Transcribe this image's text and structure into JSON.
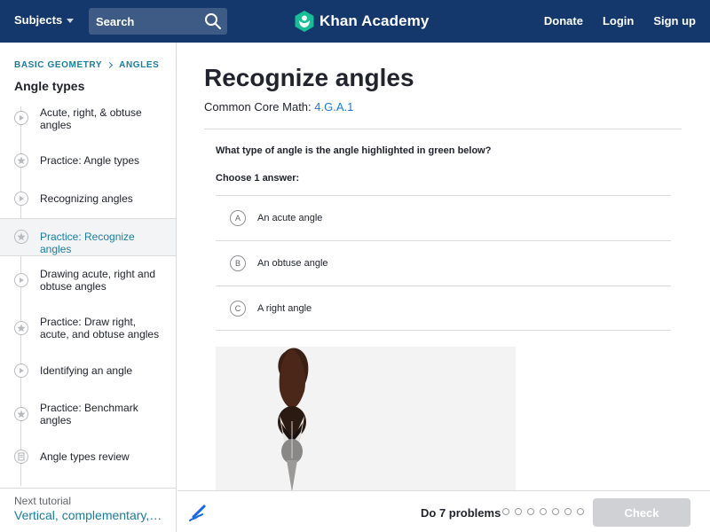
{
  "header": {
    "subjects_label": "Subjects",
    "search_placeholder": "Search",
    "brand_name": "Khan Academy",
    "links": [
      "Donate",
      "Login",
      "Sign up"
    ],
    "bg_color": "#14386b"
  },
  "sidebar": {
    "breadcrumb": [
      "BASIC GEOMETRY",
      "ANGLES"
    ],
    "title": "Angle types",
    "items": [
      {
        "label": "Acute, right, & obtuse angles",
        "icon": "play-icon",
        "active": false
      },
      {
        "label": "Practice: Angle types",
        "icon": "star-icon",
        "active": false
      },
      {
        "label": "Recognizing angles",
        "icon": "play-icon",
        "active": false
      },
      {
        "label": "Practice: Recognize angles",
        "icon": "star-icon",
        "active": true
      },
      {
        "label": "Drawing acute, right and obtuse angles",
        "icon": "play-icon",
        "active": false
      },
      {
        "label": "Practice: Draw right, acute, and obtuse angles",
        "icon": "star-icon",
        "active": false
      },
      {
        "label": "Identifying an angle",
        "icon": "play-icon",
        "active": false
      },
      {
        "label": "Practice: Benchmark angles",
        "icon": "star-icon",
        "active": false
      },
      {
        "label": "Angle types review",
        "icon": "article-icon",
        "active": false
      }
    ],
    "next_caption": "Next tutorial",
    "next_link": "Vertical, complementary, and supplementary angles"
  },
  "main": {
    "title": "Recognize angles",
    "standard_prefix": "Common Core Math:",
    "standard_code": "4.G.A.1",
    "question": "What type of angle is the angle highlighted in green below?",
    "choose_label": "Choose 1 answer:",
    "choices": [
      {
        "letter": "A",
        "text": "An acute angle"
      },
      {
        "letter": "B",
        "text": "An obtuse angle"
      },
      {
        "letter": "C",
        "text": "A right angle"
      }
    ]
  },
  "footer": {
    "do_problems": "Do 7 problems",
    "total_problems": 7,
    "check_label": "Check"
  },
  "colors": {
    "accent_teal": "#1a7d9e",
    "link_blue": "#1a7ad9",
    "check_disabled": "#cfd1d4"
  }
}
